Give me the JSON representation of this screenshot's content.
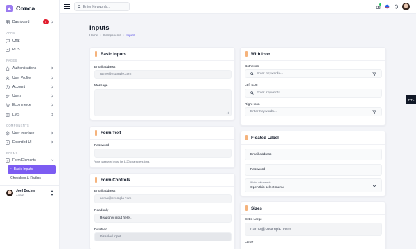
{
  "brand": {
    "name": "Conca"
  },
  "search": {
    "placeholder": "Enter Keywords..."
  },
  "sidebar": {
    "dashboard": {
      "label": "Dashboard",
      "badge": "5"
    },
    "sections": {
      "apps": "APPS",
      "pages": "PAGES",
      "components": "COMPONENTS",
      "forms": "FORMS"
    },
    "apps": [
      {
        "label": "Chat"
      },
      {
        "label": "POS"
      }
    ],
    "pages": [
      {
        "label": "Authentications"
      },
      {
        "label": "User Profile"
      },
      {
        "label": "Account"
      },
      {
        "label": "Users"
      },
      {
        "label": "Ecommerce"
      },
      {
        "label": "LMS"
      }
    ],
    "components": [
      {
        "label": "User Interface"
      },
      {
        "label": "Extended UI"
      }
    ],
    "forms": {
      "label": "Form Elements",
      "active_sub": "Basic Inputs",
      "sub": "Checkbox & Radios"
    },
    "user": {
      "name": "Joel Becker",
      "role": "Admin"
    }
  },
  "page": {
    "title": "Inputs",
    "breadcrumb": [
      "Home",
      "Components",
      "Inputs"
    ]
  },
  "basic_inputs": {
    "title": "Basic Inputs",
    "email_label": "Email address",
    "email_placeholder": "name@example.com",
    "message_label": "Message"
  },
  "form_text": {
    "title": "Form Text",
    "password_label": "Password",
    "help": "Your password must be 8-20 characters long."
  },
  "form_controls": {
    "title": "Form Controls",
    "email_label": "Email address",
    "email_placeholder": "name@example.com",
    "readonly_label": "Readonly",
    "readonly_value": "Readonly input here...",
    "disabled_label": "Disabled",
    "disabled_value": "Disabled input"
  },
  "with_icon": {
    "title": "With Icon",
    "both_label": "Both Icon",
    "left_label": "Left Icon",
    "right_label": "Right Icon",
    "placeholder": "Enter Keywords..."
  },
  "floated_label": {
    "title": "Floated Label",
    "email": "Email address",
    "password": "Password",
    "select_top": "Works with selects",
    "select_value": "Open this select menu"
  },
  "sizes": {
    "title": "Sizes",
    "xl_label": "Extra Large",
    "xl_placeholder": "name@example.com",
    "l_label": "Large"
  },
  "rtl": {
    "label": "RTL"
  },
  "colors": {
    "accent": "#7c5cf2",
    "badge": "#e11d2e",
    "card_marker": "#f5b37c"
  }
}
